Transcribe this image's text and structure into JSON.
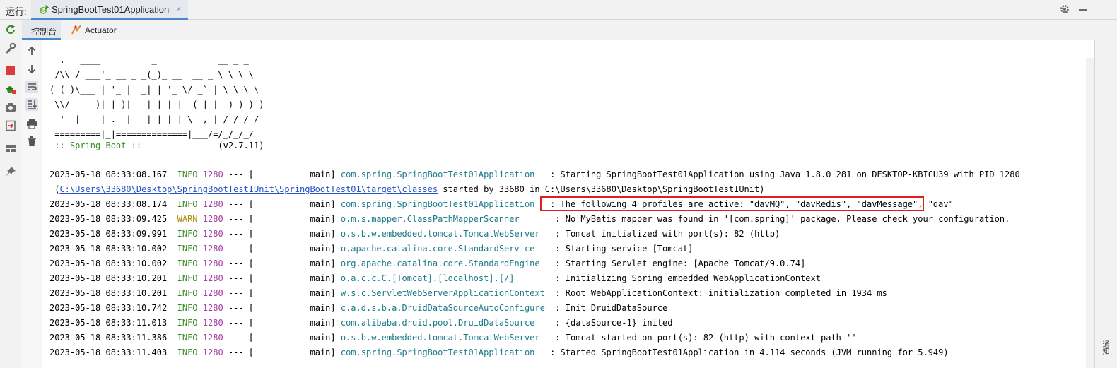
{
  "header": {
    "run_label": "运行:",
    "tab_title": "SpringBootTest01Application",
    "tab_close": "×"
  },
  "subtabs": [
    {
      "label": "控制台"
    },
    {
      "label": "Actuator"
    }
  ],
  "banner": {
    "lines": [
      "  .   ____          _            __ _ _",
      " /\\\\ / ___'_ __ _ _(_)_ __  __ _ \\ \\ \\ \\",
      "( ( )\\___ | '_ | '_| | '_ \\/ _` | \\ \\ \\ \\",
      " \\\\/  ___)| |_)| | | | | || (_| |  ) ) ) )",
      "  '  |____| .__|_| |_|_| |_\\__, | / / / /",
      " =========|_|==============|___/=/_/_/_/"
    ],
    "spring_boot_label": " :: Spring Boot :: ",
    "version": "              (v2.7.11)"
  },
  "logs": [
    {
      "timestamp": "2023-05-18 08:33:08.167",
      "level": "INFO",
      "pid": "1280",
      "sep": "--- [",
      "thread": "           main]",
      "logger": "com.spring.SpringBootTest01Application  ",
      "message": " : Starting SpringBootTest01Application using Java 1.8.0_281 on DESKTOP-KBICU39 with PID 1280"
    },
    {
      "timestamp": "2023-05-18 08:33:08.174",
      "level": "INFO",
      "pid": "1280",
      "sep": "--- [",
      "thread": "           main]",
      "logger": "com.spring.SpringBootTest01Application  ",
      "message": " : The following 4 profiles are active: \"davMQ\", \"davRedis\", \"davMessage\", \"dav\""
    },
    {
      "timestamp": "2023-05-18 08:33:09.425",
      "level": "WARN",
      "pid": "1280",
      "sep": "--- [",
      "thread": "           main]",
      "logger": "o.m.s.mapper.ClassPathMapperScanner      ",
      "message": " : No MyBatis mapper was found in '[com.spring]' package. Please check your configuration."
    },
    {
      "timestamp": "2023-05-18 08:33:09.991",
      "level": "INFO",
      "pid": "1280",
      "sep": "--- [",
      "thread": "           main]",
      "logger": "o.s.b.w.embedded.tomcat.TomcatWebServer  ",
      "message": " : Tomcat initialized with port(s): 82 (http)"
    },
    {
      "timestamp": "2023-05-18 08:33:10.002",
      "level": "INFO",
      "pid": "1280",
      "sep": "--- [",
      "thread": "           main]",
      "logger": "o.apache.catalina.core.StandardService   ",
      "message": " : Starting service [Tomcat]"
    },
    {
      "timestamp": "2023-05-18 08:33:10.002",
      "level": "INFO",
      "pid": "1280",
      "sep": "--- [",
      "thread": "           main]",
      "logger": "org.apache.catalina.core.StandardEngine  ",
      "message": " : Starting Servlet engine: [Apache Tomcat/9.0.74]"
    },
    {
      "timestamp": "2023-05-18 08:33:10.201",
      "level": "INFO",
      "pid": "1280",
      "sep": "--- [",
      "thread": "           main]",
      "logger": "o.a.c.c.C.[Tomcat].[localhost].[/]       ",
      "message": " : Initializing Spring embedded WebApplicationContext"
    },
    {
      "timestamp": "2023-05-18 08:33:10.201",
      "level": "INFO",
      "pid": "1280",
      "sep": "--- [",
      "thread": "           main]",
      "logger": "w.s.c.ServletWebServerApplicationContext ",
      "message": " : Root WebApplicationContext: initialization completed in 1934 ms"
    },
    {
      "timestamp": "2023-05-18 08:33:10.742",
      "level": "INFO",
      "pid": "1280",
      "sep": "--- [",
      "thread": "           main]",
      "logger": "c.a.d.s.b.a.DruidDataSourceAutoConfigure ",
      "message": " : Init DruidDataSource"
    },
    {
      "timestamp": "2023-05-18 08:33:11.013",
      "level": "INFO",
      "pid": "1280",
      "sep": "--- [",
      "thread": "           main]",
      "logger": "com.alibaba.druid.pool.DruidDataSource   ",
      "message": " : {dataSource-1} inited"
    },
    {
      "timestamp": "2023-05-18 08:33:11.386",
      "level": "INFO",
      "pid": "1280",
      "sep": "--- [",
      "thread": "           main]",
      "logger": "o.s.b.w.embedded.tomcat.TomcatWebServer  ",
      "message": " : Tomcat started on port(s): 82 (http) with context path ''"
    },
    {
      "timestamp": "2023-05-18 08:33:11.403",
      "level": "INFO",
      "pid": "1280",
      "sep": "--- [",
      "thread": "           main]",
      "logger": "com.spring.SpringBootTest01Application  ",
      "message": " : Started SpringBootTest01Application in 4.114 seconds (JVM running for 5.949)"
    }
  ],
  "continuation": {
    "prefix": " (",
    "path_link": "C:\\Users\\33680\\Desktop\\SpringBootTestIUnit\\SpringBootTest01\\target\\classes",
    "suffix": " started by 33680 in C:\\Users\\33680\\Desktop\\SpringBootTestIUnit)"
  },
  "right_strip_label": "通知",
  "colors": {
    "info": "#3b8b23",
    "warn": "#b08c00",
    "pid": "#a23ba0",
    "logger": "#1c7a8a",
    "link": "#2450c8",
    "highlight_border": "#e02020",
    "tab_underline": "#4a88c7"
  },
  "icons": {
    "tab_icon": "spring-boot-run-icon",
    "toolbar": [
      "rerun-icon",
      "wrench-icon",
      "stop-icon",
      "debug-icon",
      "camera-icon",
      "exit-icon",
      "layout-icon",
      "pin-icon"
    ],
    "console_tools": [
      "up-arrow-icon",
      "down-arrow-icon",
      "soft-wrap-icon",
      "scroll-to-end-icon",
      "print-icon",
      "trash-icon"
    ]
  }
}
